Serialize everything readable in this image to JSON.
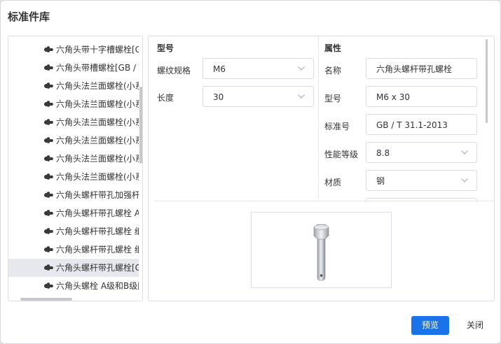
{
  "dialog": {
    "title": "标准件库",
    "preview_button": "预览",
    "close_button": "关闭"
  },
  "tree": {
    "items": [
      {
        "label": "六角头带十字槽螺栓[G",
        "selected": false
      },
      {
        "label": "六角头带槽螺栓[GB / T",
        "selected": false
      },
      {
        "label": "六角头法兰面螺栓(小系",
        "selected": false
      },
      {
        "label": "六角头法兰面螺栓(小系",
        "selected": false
      },
      {
        "label": "六角头法兰面螺栓(小系",
        "selected": false
      },
      {
        "label": "六角头法兰面螺栓(小系",
        "selected": false
      },
      {
        "label": "六角头法兰面螺栓(小系",
        "selected": false
      },
      {
        "label": "六角头法兰面螺栓(小系",
        "selected": false
      },
      {
        "label": "六角头螺杆带孔加强杆",
        "selected": false
      },
      {
        "label": "六角头螺杆带孔螺栓 A",
        "selected": false
      },
      {
        "label": "六角头螺杆带孔螺栓 细",
        "selected": false
      },
      {
        "label": "六角头螺杆带孔螺栓 细",
        "selected": false
      },
      {
        "label": "六角头螺杆带孔螺栓[G",
        "selected": true
      },
      {
        "label": "六角头螺栓 A级和B级[",
        "selected": false
      }
    ],
    "item_icon": "bolt-icon"
  },
  "model": {
    "section_title": "型号",
    "thread_spec": {
      "label": "螺纹规格",
      "value": "M6"
    },
    "length": {
      "label": "长度",
      "value": "30"
    }
  },
  "properties": {
    "section_title": "属性",
    "name": {
      "label": "名称",
      "value": "六角头螺杆带孔螺栓"
    },
    "model_no": {
      "label": "型号",
      "value": "M6 x 30"
    },
    "standard_no": {
      "label": "标准号",
      "value": "GB / T 31.1-2013"
    },
    "grade": {
      "label": "性能等级",
      "value": "8.8"
    },
    "material": {
      "label": "材质",
      "value": "钢"
    }
  },
  "colors": {
    "accent": "#1a73e8",
    "selected_row": "#e6e8ee"
  }
}
